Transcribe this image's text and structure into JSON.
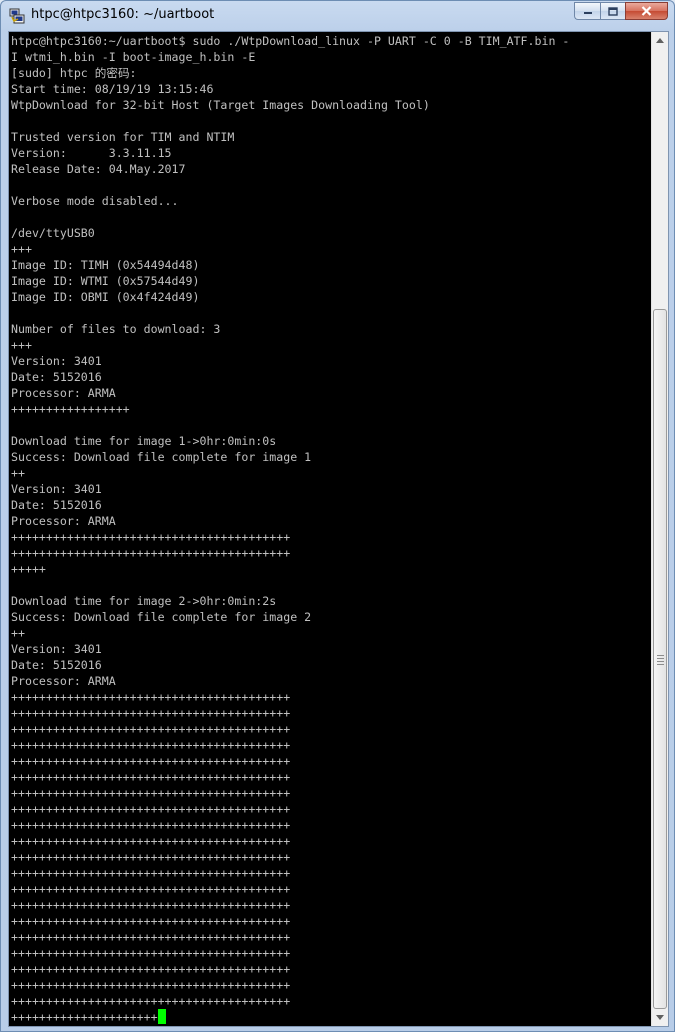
{
  "window": {
    "title": "htpc@htpc3160: ~/uartboot"
  },
  "terminal": {
    "lines": [
      "htpc@htpc3160:~/uartboot$ sudo ./WtpDownload_linux -P UART -C 0 -B TIM_ATF.bin -",
      "I wtmi_h.bin -I boot-image_h.bin -E",
      "[sudo] htpc 的密码:",
      "Start time: 08/19/19 13:15:46",
      "WtpDownload for 32-bit Host (Target Images Downloading Tool)",
      "",
      "Trusted version for TIM and NTIM",
      "Version:      3.3.11.15",
      "Release Date: 04.May.2017",
      "",
      "Verbose mode disabled...",
      "",
      "/dev/ttyUSB0",
      "+++",
      "Image ID: TIMH (0x54494d48)",
      "Image ID: WTMI (0x57544d49)",
      "Image ID: OBMI (0x4f424d49)",
      "",
      "Number of files to download: 3",
      "+++",
      "Version: 3401",
      "Date: 5152016",
      "Processor: ARMA",
      "+++++++++++++++++",
      "",
      "Download time for image 1->0hr:0min:0s",
      "Success: Download file complete for image 1",
      "++",
      "Version: 3401",
      "Date: 5152016",
      "Processor: ARMA",
      "++++++++++++++++++++++++++++++++++++++++",
      "++++++++++++++++++++++++++++++++++++++++",
      "+++++",
      "",
      "Download time for image 2->0hr:0min:2s",
      "Success: Download file complete for image 2",
      "++",
      "Version: 3401",
      "Date: 5152016",
      "Processor: ARMA",
      "++++++++++++++++++++++++++++++++++++++++",
      "++++++++++++++++++++++++++++++++++++++++",
      "++++++++++++++++++++++++++++++++++++++++",
      "++++++++++++++++++++++++++++++++++++++++",
      "++++++++++++++++++++++++++++++++++++++++",
      "++++++++++++++++++++++++++++++++++++++++",
      "++++++++++++++++++++++++++++++++++++++++",
      "++++++++++++++++++++++++++++++++++++++++",
      "++++++++++++++++++++++++++++++++++++++++",
      "++++++++++++++++++++++++++++++++++++++++",
      "++++++++++++++++++++++++++++++++++++++++",
      "++++++++++++++++++++++++++++++++++++++++",
      "++++++++++++++++++++++++++++++++++++++++",
      "++++++++++++++++++++++++++++++++++++++++",
      "++++++++++++++++++++++++++++++++++++++++",
      "++++++++++++++++++++++++++++++++++++++++",
      "++++++++++++++++++++++++++++++++++++++++",
      "++++++++++++++++++++++++++++++++++++++++",
      "++++++++++++++++++++++++++++++++++++++++",
      "++++++++++++++++++++++++++++++++++++++++",
      "+++++++++++++++++++++"
    ],
    "colors": {
      "background": "#000000",
      "foreground": "#c0c0c0",
      "cursor": "#00ff00"
    }
  },
  "icons": {
    "app": "putty-icon",
    "minimize": "minimize-icon",
    "maximize": "maximize-icon",
    "close": "close-icon"
  }
}
